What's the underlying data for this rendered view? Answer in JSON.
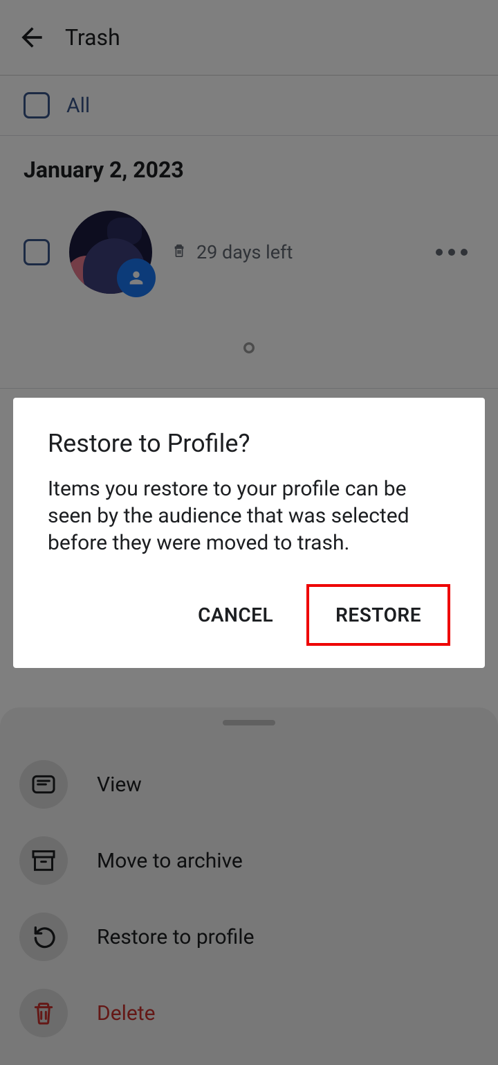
{
  "header": {
    "title": "Trash"
  },
  "filter": {
    "all_label": "All"
  },
  "section_date": "January 2, 2023",
  "item": {
    "days_left": "29 days left"
  },
  "dialog": {
    "title": "Restore to Profile?",
    "body": "Items you restore to your profile can be seen by the audience that was selected before they were moved to trash.",
    "cancel": "CANCEL",
    "restore": "RESTORE"
  },
  "sheet": {
    "view": "View",
    "archive": "Move to archive",
    "restore": "Restore to profile",
    "delete": "Delete"
  }
}
